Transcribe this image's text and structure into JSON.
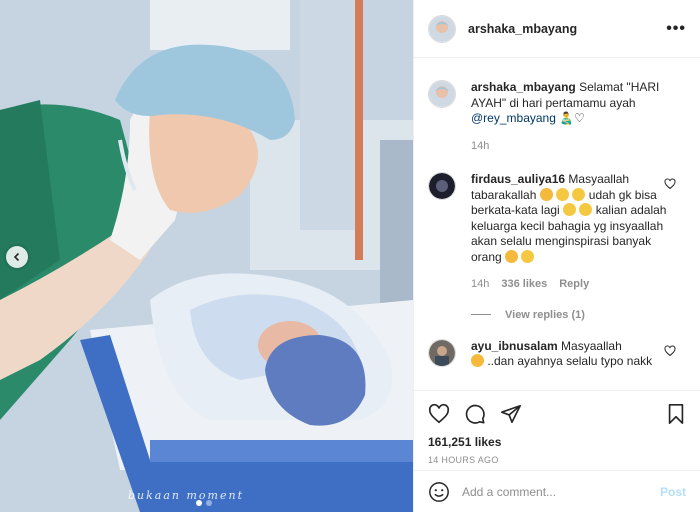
{
  "photo": {
    "watermark": "bukaan moment",
    "carousel_dots": 2,
    "active_dot": 1
  },
  "header": {
    "username": "arshaka_mbayang",
    "more_icon": "more-horizontal-icon"
  },
  "caption": {
    "username": "arshaka_mbayang",
    "text": "Selamat \"HARI AYAH\" di hari pertamamu ayah",
    "mention": "@rey_mbayang",
    "emoji_text": "👨‍🍼♡",
    "time": "14h"
  },
  "comments": [
    {
      "username": "firdaus_auliya16",
      "text_1": "Masyaallah tabarakallah",
      "text_2": "udah gk bisa berkata-kata lagi",
      "text_3": "kalian adalah keluarga kecil bahagia yg insyaallah akan selalu menginspirasi banyak orang",
      "time": "14h",
      "likes": "336 likes",
      "reply_label": "Reply",
      "view_replies": "View replies (1)"
    },
    {
      "username": "ayu_ibnusalam",
      "text_1": "Masyaallah",
      "text_2": "..dan ayahnya selalu typo nakk"
    }
  ],
  "actions": {
    "like_count": "161,251 likes",
    "post_time": "14 HOURS AGO"
  },
  "add_comment": {
    "placeholder": "Add a comment...",
    "post_label": "Post"
  },
  "colors": {
    "scrub_green": "#2a8a6a",
    "cap_blue": "#9ec7dd",
    "link": "#00376b",
    "muted": "#8e8e8e",
    "post_disabled": "#b2dffc"
  }
}
